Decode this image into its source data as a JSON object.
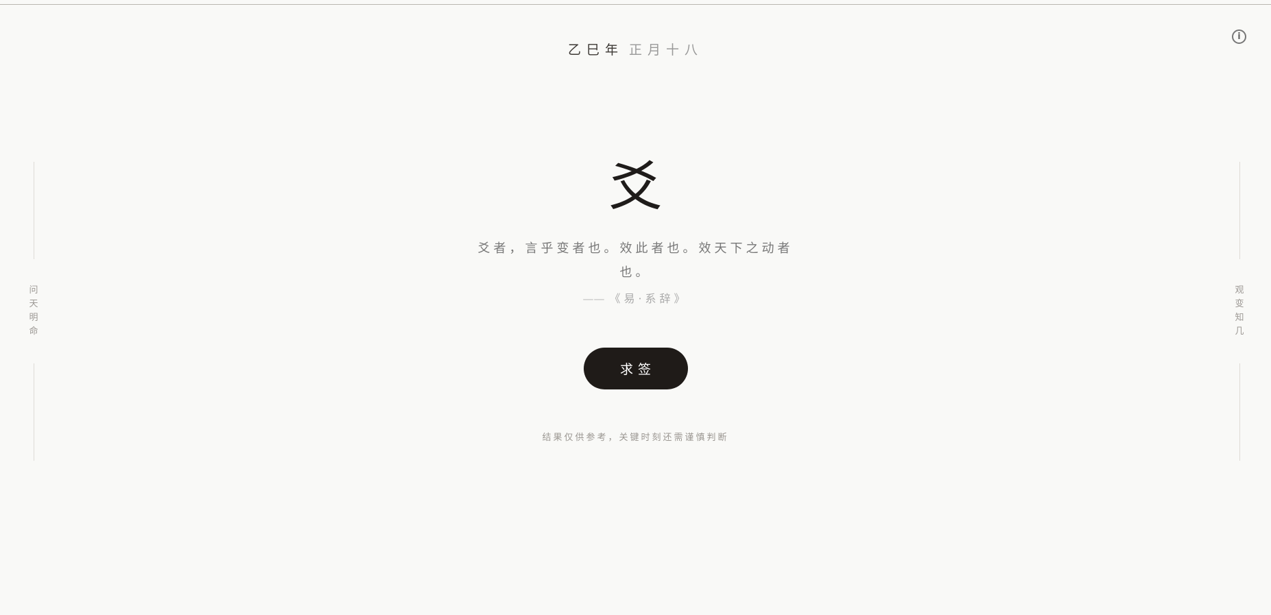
{
  "header": {
    "year": "乙巳年",
    "month_day": "正月十八",
    "info_icon": "i"
  },
  "sidebar_left": {
    "chars": [
      "问",
      "天",
      "明",
      "命"
    ]
  },
  "sidebar_right": {
    "chars": [
      "观",
      "变",
      "知",
      "几"
    ]
  },
  "main": {
    "glyph": "爻",
    "quote": "爻者，言乎变者也。效此者也。效天下之动者也。",
    "source_dash": "——",
    "source": "《易·系辞》",
    "button_label": "求签",
    "disclaimer": "结果仅供参考，关键时刻还需谨慎判断"
  },
  "colors": {
    "background": "#f9f9f7",
    "button": "#1f1b18",
    "text": "#1f1c1a",
    "muted": "#9b9792"
  }
}
